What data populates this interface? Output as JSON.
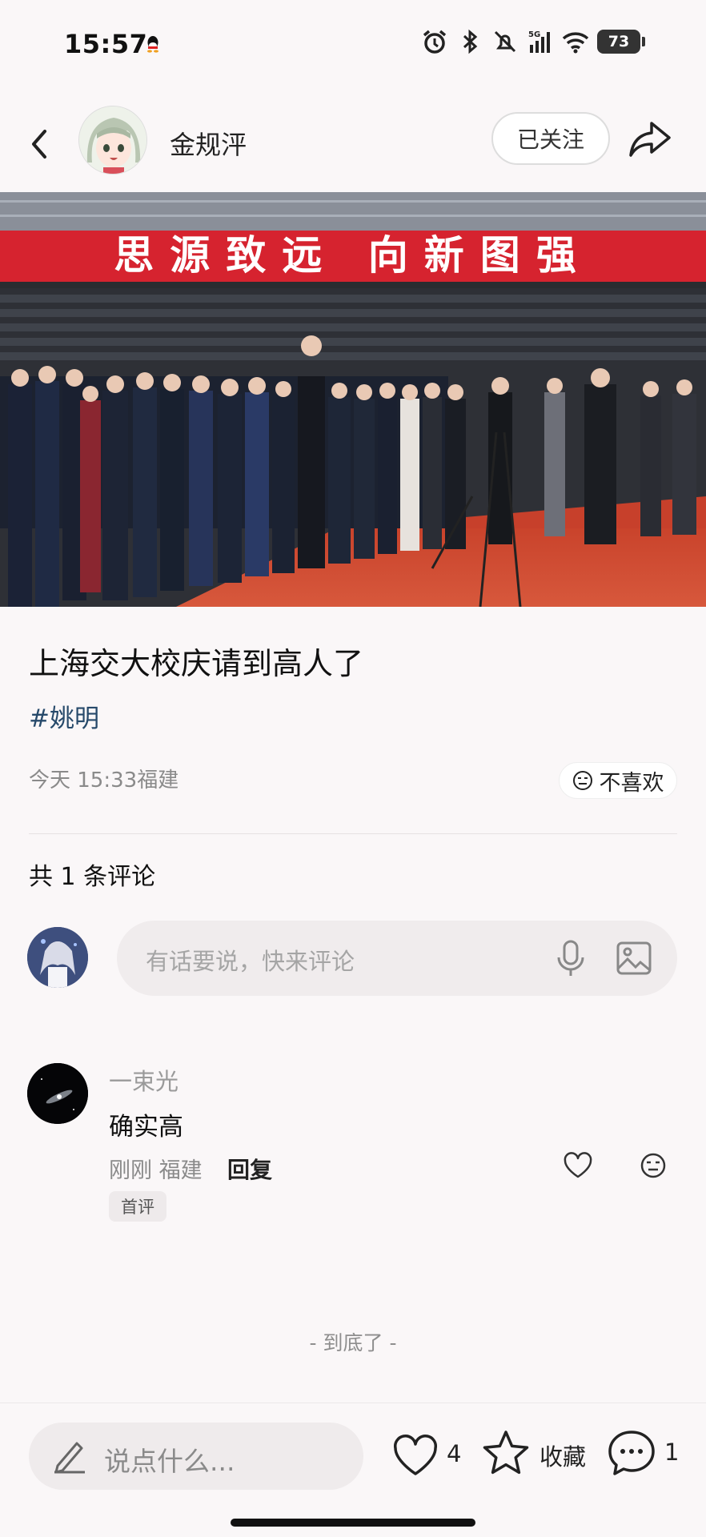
{
  "status_bar": {
    "time": "15:57",
    "battery": "73",
    "network": "5G"
  },
  "header": {
    "author_name": "金规泙",
    "follow_label": "已关注"
  },
  "post": {
    "banner_text": "思源致远 向新图强",
    "title": "上海交大校庆请到高人了",
    "tag": "#姚明",
    "meta": "今天 15:33福建",
    "dislike_label": "不喜欢"
  },
  "comments": {
    "count_label": "共 1 条评论",
    "input_placeholder": "有话要说，快来评论",
    "items": [
      {
        "user": "一束光",
        "text": "确实高",
        "meta": "刚刚 福建",
        "reply_label": "回复",
        "badge": "首评"
      }
    ],
    "end_label": "- 到底了 -"
  },
  "bottom_bar": {
    "say_placeholder": "说点什么...",
    "like_count": "4",
    "collect_label": "收藏",
    "comment_count": "1"
  },
  "icons": [
    "back-icon",
    "share-icon",
    "dislike-icon",
    "mic-icon",
    "image-icon",
    "heart-icon",
    "star-icon",
    "comment-icon",
    "pen-icon",
    "alarm-icon",
    "bluetooth-icon",
    "mute-icon",
    "signal-icon",
    "wifi-icon"
  ],
  "colors": {
    "tag": "#274a6b",
    "banner_red": "#d6232f",
    "background": "#faf7f8"
  }
}
